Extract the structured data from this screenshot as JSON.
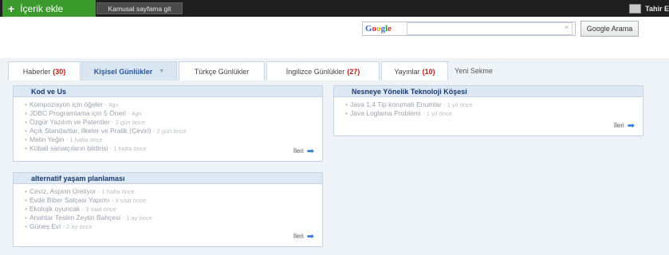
{
  "topbar": {
    "add_content_label": "İçerik ekle",
    "public_page_label": "Kamusal sayfama git",
    "user_name": "Tahir E"
  },
  "search": {
    "logo_text": "Google",
    "input_value": "",
    "clear_icon": "x-icon",
    "button_label": "Google Arama"
  },
  "tabs": [
    {
      "label": "Haberler",
      "count": "(30)"
    },
    {
      "label": "Kişisel Günlükler",
      "count": ""
    },
    {
      "label": "Türkçe Günlükler",
      "count": ""
    },
    {
      "label": "İngilizce Günlükler",
      "count": "(27)"
    },
    {
      "label": "Yayınlar",
      "count": "(10)"
    },
    {
      "label": "Yeni Sekme",
      "count": ""
    }
  ],
  "boxes": [
    {
      "title": "Kod ve Us",
      "items": [
        {
          "text": "Kompozisyon için öğeler",
          "age": "- 4gn"
        },
        {
          "text": "JDBC Programlama için 5 Öneri",
          "age": "- 4gn"
        },
        {
          "text": "Özgür Yazılım ve Patentler",
          "age": "- 2 gün önce"
        },
        {
          "text": "Açık Standartlar, İlkeler ve Pratik (Çeviri)",
          "age": "- 2 gün önce"
        },
        {
          "text": "Melin Yeğin",
          "age": "- 1 hafta önce"
        },
        {
          "text": "Kübali sanatçıların bildirisi",
          "age": "- 1 hafta önce"
        }
      ],
      "more_label": "İleri"
    },
    {
      "title": "Nesneye Yönelik Teknoloji Köşesi",
      "items": [
        {
          "text": "Java 1.4 Tip korumalı Enumlar",
          "age": "- 1 yıl önce"
        },
        {
          "text": "Java Loglama Problemi",
          "age": "- 1 yıl önce"
        }
      ],
      "more_label": "İleri"
    },
    {
      "title": "alternatif yaşam planlaması",
      "items": [
        {
          "text": "Ceviz, Aspirin Üretiyor",
          "age": "- 1 hafta önce"
        },
        {
          "text": "Evde Biber Salçası Yapımı",
          "age": "- 3 saat önce"
        },
        {
          "text": "Ekolojik oyuncak",
          "age": "- 3 saat önce"
        },
        {
          "text": "Anahtar Teslim Zeytin Bahçesi",
          "age": "- 1 ay önce"
        },
        {
          "text": "Güneş Evi",
          "age": "- 2 ay önce"
        }
      ],
      "more_label": "İleri"
    }
  ],
  "icons": {
    "more_arrow": "right-arrow-icon",
    "tab_menu": "chevron-down-icon",
    "user_avatar": "avatar-icon"
  },
  "colors": {
    "topbar": "#1f1f1f",
    "add_button": "#3a9a2b",
    "count_red": "#c01818",
    "box_title": "#1a3b6e",
    "arrow_blue": "#2f7bd8"
  }
}
